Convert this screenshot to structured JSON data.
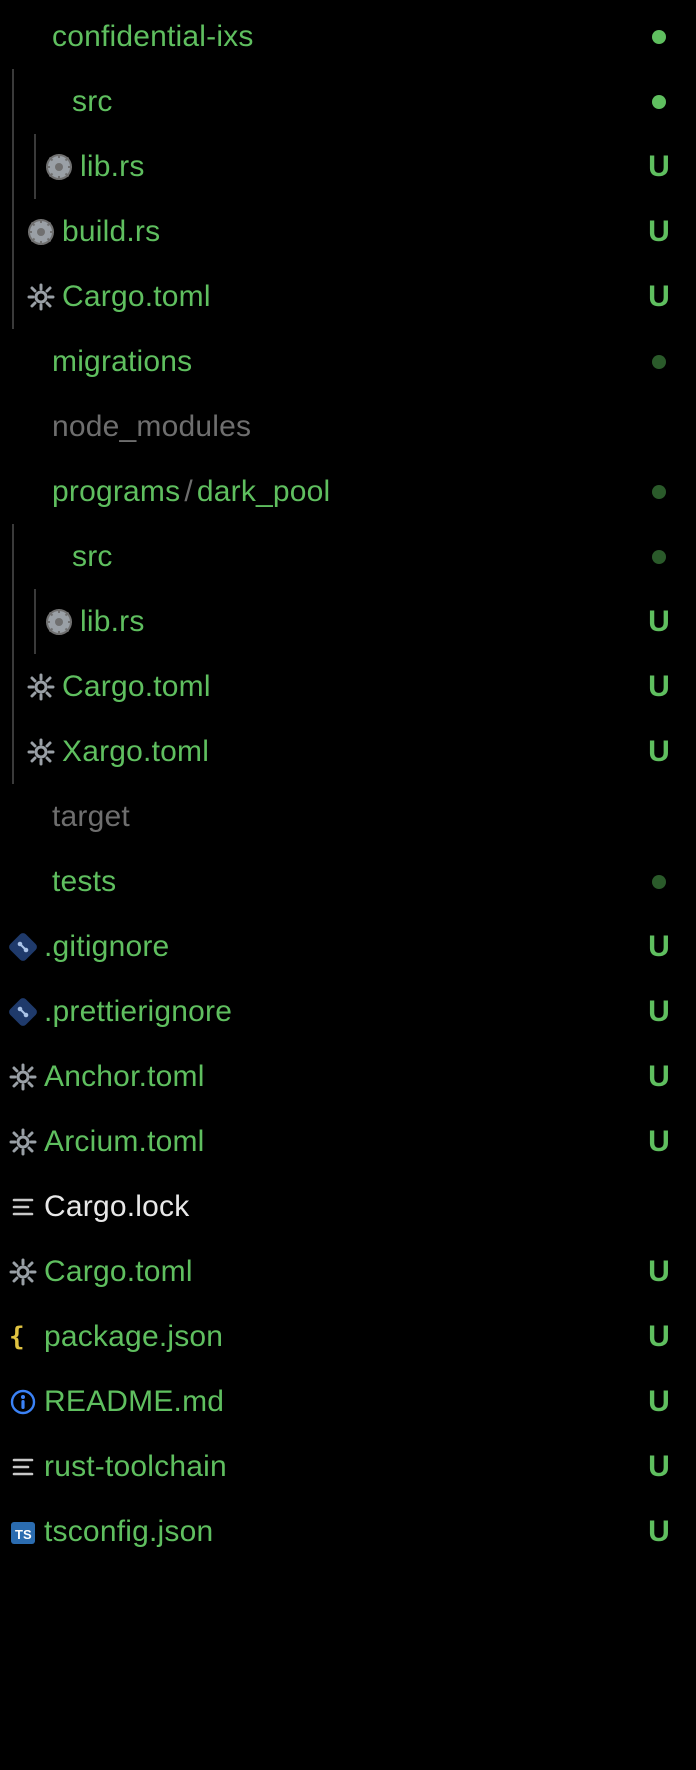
{
  "status": {
    "untracked": "U"
  },
  "tree": {
    "confidential_ixs": {
      "label": "confidential-ixs",
      "src": {
        "label": "src",
        "lib_rs": "lib.rs"
      },
      "build_rs": "build.rs",
      "cargo_toml": "Cargo.toml"
    },
    "migrations": {
      "label": "migrations"
    },
    "node_modules": {
      "label": "node_modules"
    },
    "programs_dark_pool": {
      "label_a": "programs",
      "label_b": "dark_pool",
      "src": {
        "label": "src",
        "lib_rs": "lib.rs"
      },
      "cargo_toml": "Cargo.toml",
      "xargo_toml": "Xargo.toml"
    },
    "target": {
      "label": "target"
    },
    "tests": {
      "label": "tests"
    },
    "files": {
      "gitignore": ".gitignore",
      "prettierignore": ".prettierignore",
      "anchor_toml": "Anchor.toml",
      "arcium_toml": "Arcium.toml",
      "cargo_lock": "Cargo.lock",
      "cargo_toml": "Cargo.toml",
      "package_json": "package.json",
      "readme_md": "README.md",
      "rust_toolchain": "rust-toolchain",
      "tsconfig_json": "tsconfig.json"
    }
  }
}
